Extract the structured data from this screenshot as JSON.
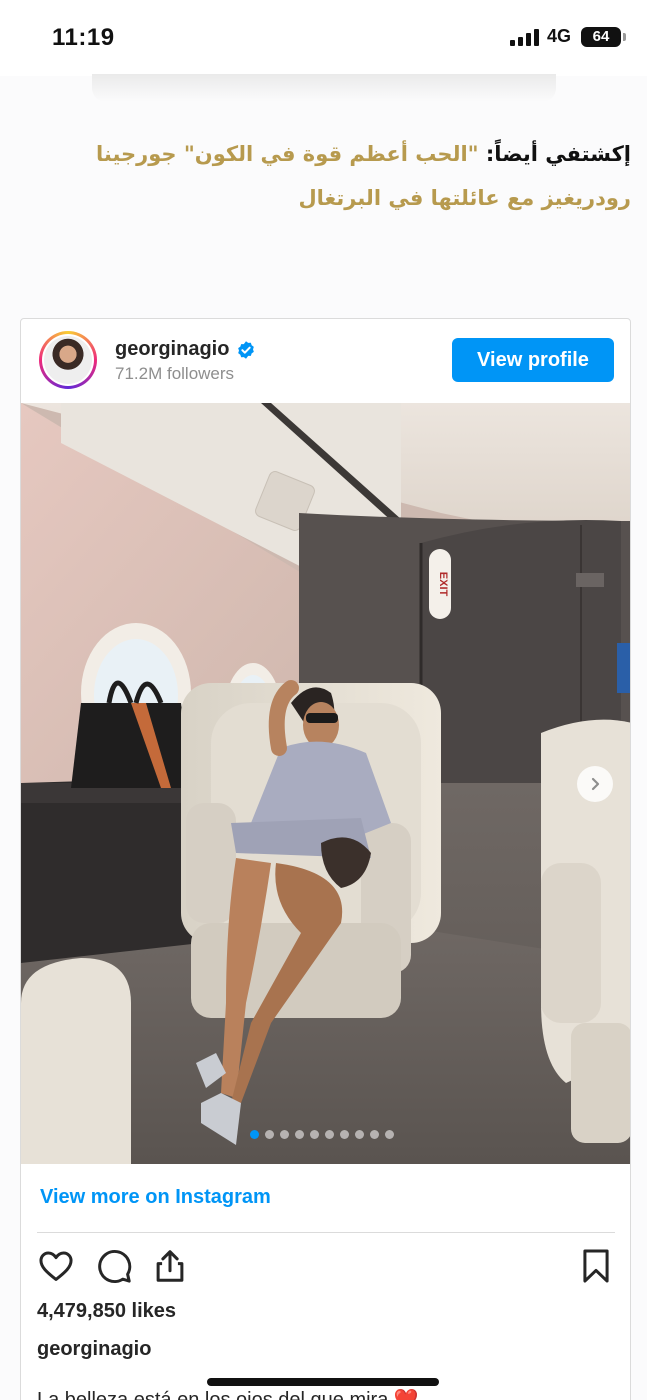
{
  "status_bar": {
    "time": "11:19",
    "network": "4G",
    "battery": "64"
  },
  "related_article": {
    "prefix": "إكشتفي أيضاً:",
    "title": "\"الحب أعظم قوة في الكون\" جورجينا رودريغيز مع عائلتها في البرتغال"
  },
  "instagram": {
    "username": "georginagio",
    "followers": "71.2M followers",
    "view_profile_label": "View profile",
    "exit_sign": "EXIT",
    "carousel": {
      "current": 1,
      "total": 10
    },
    "view_more_label": "View more on Instagram",
    "likes": "4,479,850 likes",
    "caption_username": "georginagio",
    "caption_partial": "La belleza está en los ojos del que mira ❤️"
  },
  "colors": {
    "accent": "#0095f6",
    "related_link": "#b79a4e"
  }
}
